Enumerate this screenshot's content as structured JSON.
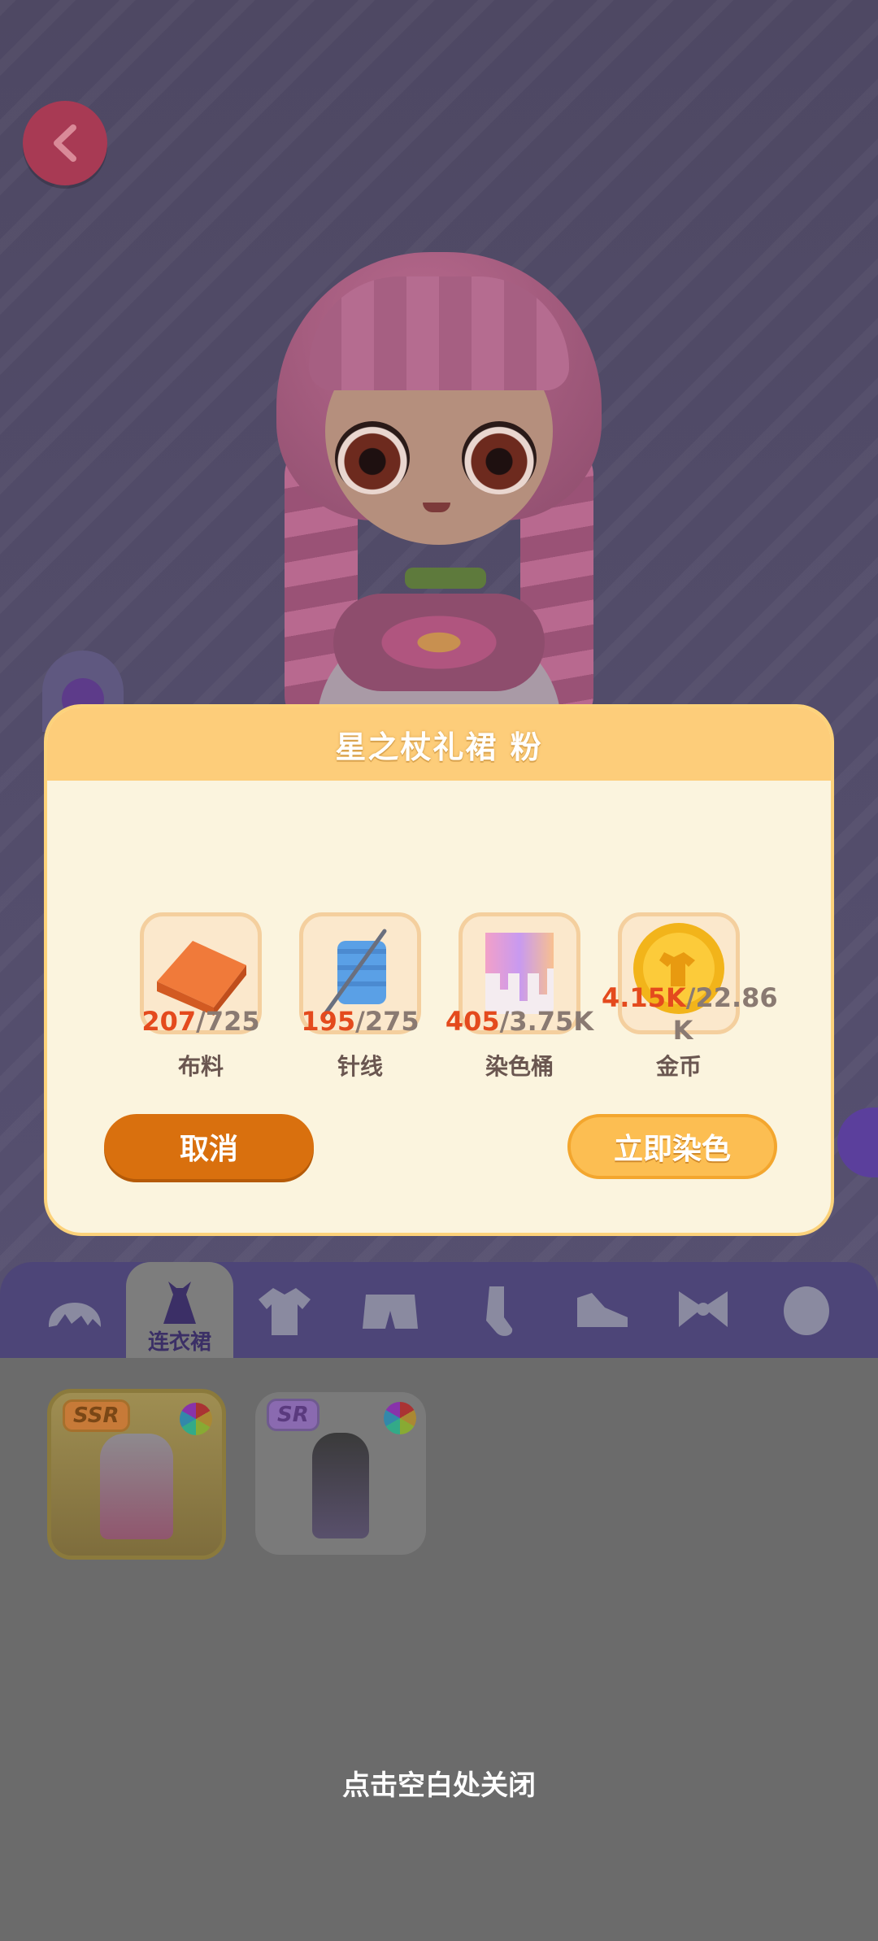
{
  "dialog": {
    "title": "星之杖礼裙 粉",
    "resources": [
      {
        "name": "布料",
        "have": "207",
        "need": "/725",
        "icon": "fabric-icon"
      },
      {
        "name": "针线",
        "have": "195",
        "need": "/275",
        "icon": "needle-thread-icon"
      },
      {
        "name": "染色桶",
        "have": "405",
        "need": "/3.75K",
        "icon": "dye-bucket-icon"
      },
      {
        "name": "金币",
        "have": "4.15K",
        "need": "/22.86\nK",
        "icon": "gold-coin-icon"
      }
    ],
    "cancel_label": "取消",
    "confirm_label": "立即染色"
  },
  "category_tabs": {
    "active_label": "连衣裙",
    "icons": [
      "hair-icon",
      "dress-icon",
      "shirt-icon",
      "shorts-icon",
      "sock-icon",
      "shoe-icon",
      "bow-icon",
      "face-icon"
    ]
  },
  "items": [
    {
      "rarity": "SSR"
    },
    {
      "rarity": "SR"
    }
  ],
  "close_hint": "点击空白处关闭",
  "colors": {
    "accent_orange": "#d9700e",
    "header_yellow": "#fdcd7a",
    "count_red": "#e44a1d"
  }
}
